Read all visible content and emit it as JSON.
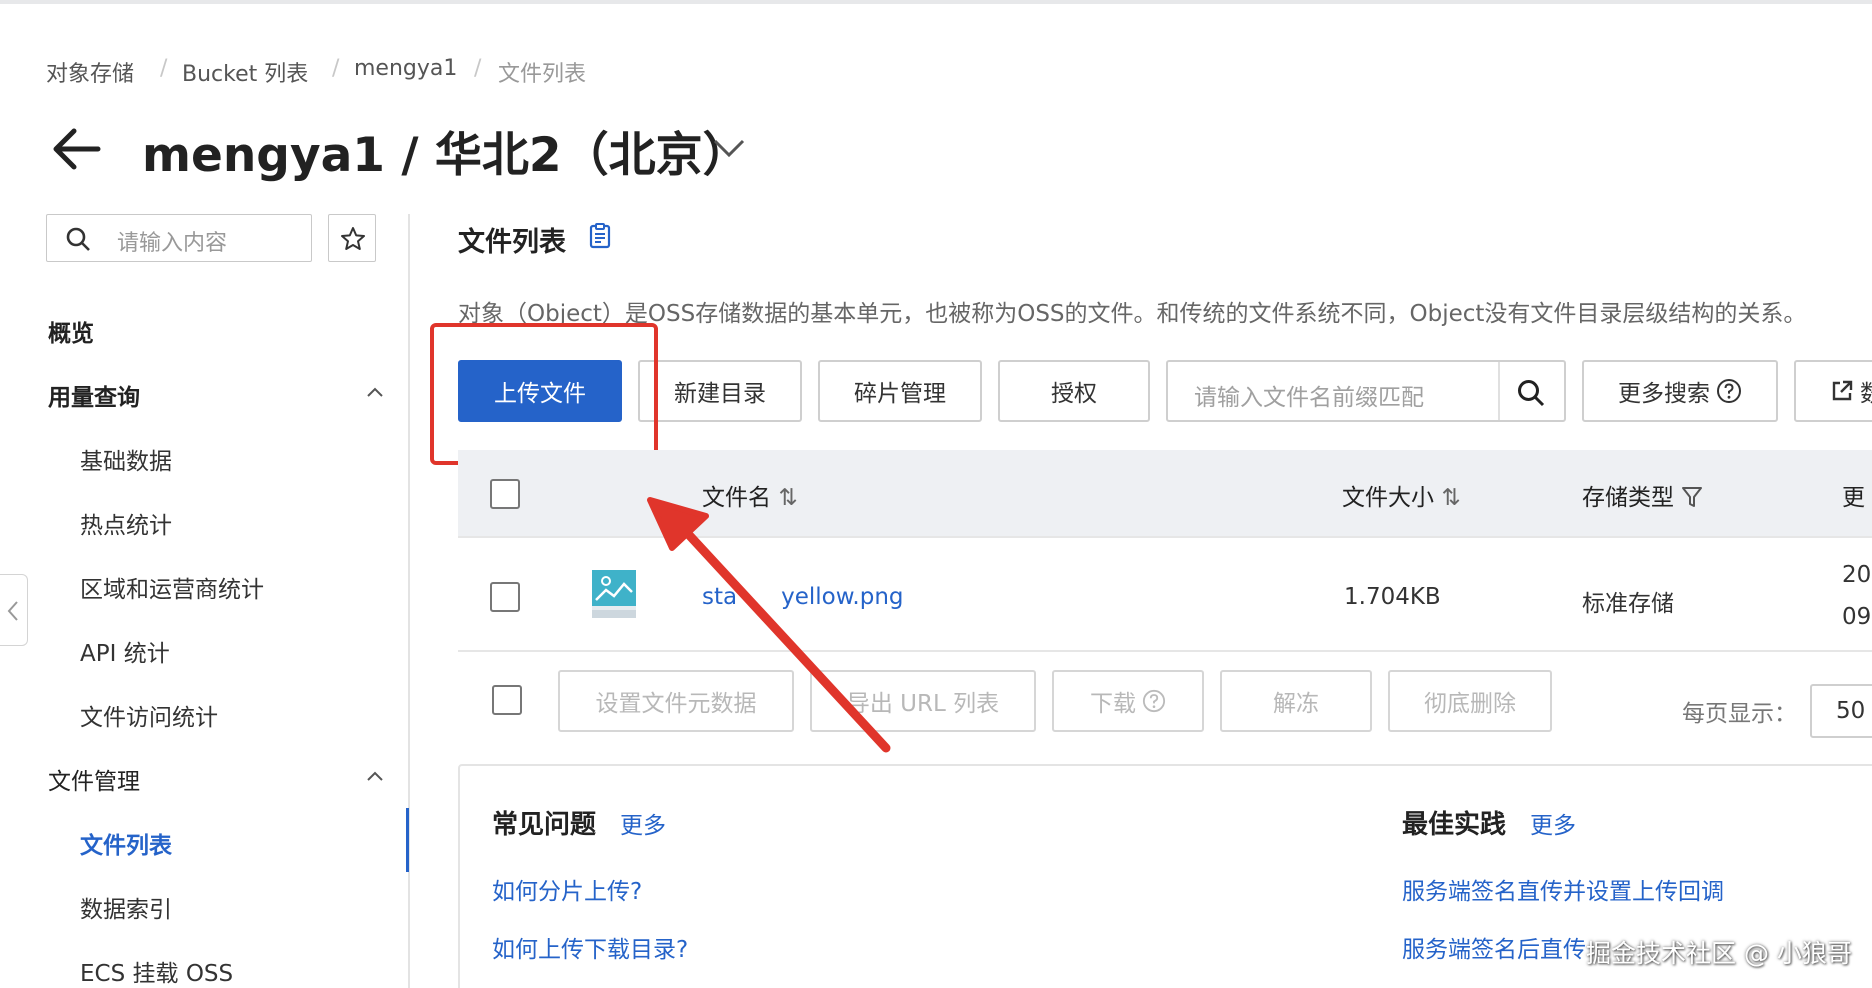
{
  "breadcrumb": [
    "对象存储",
    "Bucket 列表",
    "mengya1",
    "文件列表"
  ],
  "page_title": "mengya1 / 华北2（北京）",
  "sidebar": {
    "search_placeholder": "请输入内容",
    "overview": "概览",
    "usage_group": "用量查询",
    "usage_items": [
      "基础数据",
      "热点统计",
      "区域和运营商统计",
      "API 统计",
      "文件访问统计"
    ],
    "file_group": "文件管理",
    "file_items": [
      "文件列表",
      "数据索引",
      "ECS 挂载 OSS"
    ]
  },
  "main": {
    "section_title": "文件列表",
    "description": "对象（Object）是OSS存储数据的基本单元，也被称为OSS的文件。和传统的文件系统不同，Object没有文件目录层级结构的关系。",
    "toolbar": {
      "upload": "上传文件",
      "new_dir": "新建目录",
      "fragments": "碎片管理",
      "authorize": "授权",
      "search_placeholder": "请输入文件名前缀匹配",
      "more_search": "更多搜索",
      "export_partial": "数"
    },
    "table": {
      "col_name": "文件名",
      "col_size": "文件大小",
      "col_storage": "存储类型",
      "col_more": "更",
      "rows": [
        {
          "name": "star-yellow.png",
          "name_visible": "sta",
          "name_tail": "yellow.png",
          "size": "1.704KB",
          "storage": "标准存储",
          "date_1": "20",
          "date_2": "09"
        }
      ]
    },
    "batch": {
      "set_meta": "设置文件元数据",
      "export_url": "导出 URL 列表",
      "download": "下载",
      "unfreeze": "解冻",
      "delete": "彻底删除",
      "page_size_label": "每页显示：",
      "page_size": "50"
    },
    "faq": {
      "title": "常见问题",
      "more": "更多",
      "links": [
        "如何分片上传?",
        "如何上传下载目录?"
      ]
    },
    "best": {
      "title": "最佳实践",
      "more": "更多",
      "links": [
        "服务端签名直传并设置上传回调",
        "服务端签名后直传"
      ]
    }
  },
  "watermark": "掘金技术社区 @ 小狼哥",
  "colors": {
    "primary": "#2563c9",
    "annotation": "#e0352b"
  }
}
